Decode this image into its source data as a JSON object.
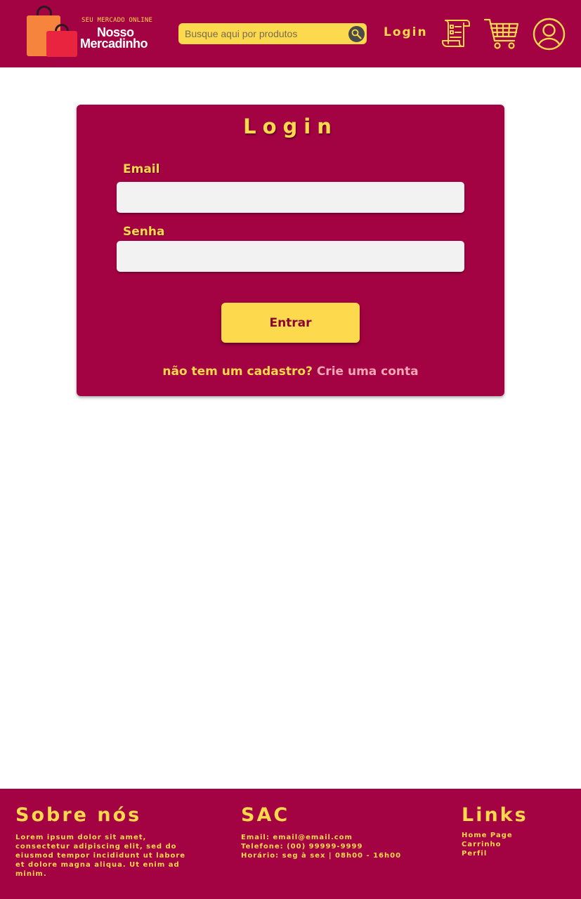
{
  "brand": {
    "tagline": "SEU MERCADO ONLINE",
    "name_line1": "Nosso",
    "name_line2": "Mercadinho"
  },
  "header": {
    "search_placeholder": "Busque aqui por produtos",
    "login_link": "Login",
    "icons": [
      "search-icon",
      "orders-icon",
      "cart-icon",
      "profile-icon"
    ]
  },
  "login_form": {
    "title": "Login",
    "email_label": "Email",
    "email_value": "",
    "password_label": "Senha",
    "password_value": "",
    "submit_label": "Entrar",
    "signup_question": "não tem um cadastro?",
    "signup_link": "Crie uma conta"
  },
  "footer": {
    "about_title": "Sobre nós",
    "about_text": "Lorem ipsum dolor sit amet, consectetur adipiscing elit, sed do eiusmod tempor incididunt ut labore et dolore magna aliqua. Ut enim ad minim.",
    "sac_title": "SAC",
    "sac_lines": [
      "Email: email@email.com",
      "Telefone: (00) 99999-9999",
      "Horário: seg à sex | 08h00 - 16h00"
    ],
    "links_title": "Links",
    "links": [
      "Home Page",
      "Carrinho",
      "Perfil"
    ]
  },
  "colors": {
    "primary": "#a30342",
    "accent": "#ffd84d",
    "button": "#fcd94d",
    "link_pink": "#f4a6b4",
    "field_bg": "#f2f2f2"
  }
}
